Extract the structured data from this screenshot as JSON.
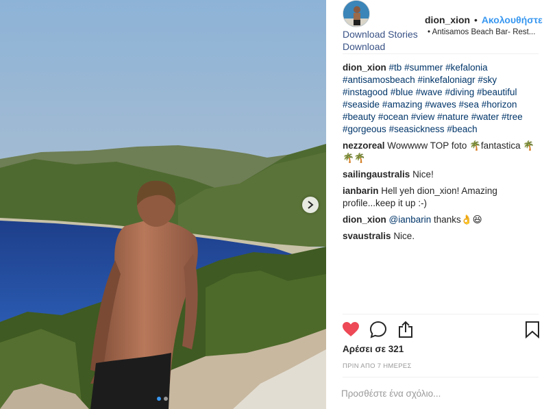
{
  "post": {
    "username": "dion_xion",
    "separator": "•",
    "follow_label": "Ακολουθήστε",
    "location": "• Antisamos Beach Bar- Rest...",
    "download_stories_label": "Download Stories",
    "download_label": "Download"
  },
  "caption": {
    "user": "dion_xion",
    "hashtags": [
      "#tb",
      "#summer",
      "#kefalonia",
      "#antisamosbeach",
      "#inkefaloniagr",
      "#sky",
      "#instagood",
      "#blue",
      "#wave",
      "#diving",
      "#beautiful",
      "#seaside",
      "#amazing",
      "#waves",
      "#sea",
      "#horizon",
      "#beauty",
      "#ocean",
      "#view",
      "#nature",
      "#water",
      "#tree",
      "#gorgeous",
      "#seasickness",
      "#beach"
    ]
  },
  "comments": [
    {
      "user": "nezzoreal",
      "text": "Wowwww TOP foto 🌴fantastica 🌴🌴🌴"
    },
    {
      "user": "sailingaustralis",
      "text": "Nice!"
    },
    {
      "user": "ianbarin",
      "text": "Hell yeh dion_xion! Amazing profile...keep it up :-)"
    },
    {
      "user": "dion_xion",
      "mention": "@ianbarin",
      "text": " thanks👌😆"
    },
    {
      "user": "svaustralis",
      "text": "Nice."
    }
  ],
  "actions": {
    "icons": [
      "heart-icon",
      "comment-icon",
      "share-icon",
      "bookmark-icon"
    ],
    "liked_color": "#ed4956"
  },
  "likes_text": "Αρέσει σε 321",
  "timestamp": "ΠΡΙΝ ΑΠΟ 7 ΗΜΕΡΕΣ",
  "comment_placeholder": "Προσθέστε ένα σχόλιο...",
  "carousel": {
    "slide_count": 2,
    "active_index": 0
  }
}
